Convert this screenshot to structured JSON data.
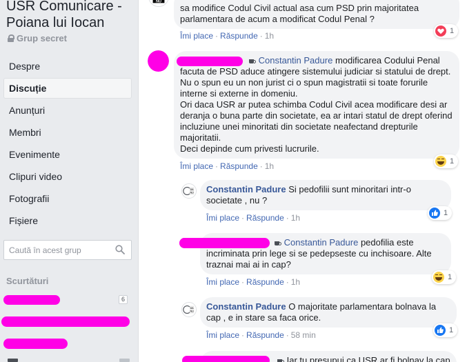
{
  "group": {
    "title": "USR Comunicare - Poiana lui Iocan",
    "privacy": "Grup secret"
  },
  "nav": [
    {
      "label": "Despre"
    },
    {
      "label": "Discuție"
    },
    {
      "label": "Anunțuri"
    },
    {
      "label": "Membri"
    },
    {
      "label": "Evenimente"
    },
    {
      "label": "Clipuri video"
    },
    {
      "label": "Fotografii"
    },
    {
      "label": "Fișiere"
    }
  ],
  "search": {
    "placeholder": "Caută în acest grup"
  },
  "shortcuts": {
    "heading": "Scurtături",
    "badge": "6"
  },
  "actions": {
    "like": "Îmi place",
    "reply": "Răspunde"
  },
  "comments": [
    {
      "text": "sa modifice Codul Civil actual asa cum PSD prin majoritatea parlamentara de acum a modificat Codul Penal ?",
      "time": "1h",
      "reaction_count": "1",
      "reaction": "love"
    },
    {
      "tag": "Constantin Padure",
      "text_first": "modificarea Codului Penal facuta de PSD aduce atingere sistemului judiciar si statului de drept.",
      "text_lines": [
        "Nu o spun eu un non jurist ci o spun magistratii si toate forurile interne si externe in domeniu.",
        "Ori daca USR ar putea schimba Codul Civil acea modificare desi ar deranja o buna parte din societate, ea ar intari statul de drept oferind incluziune unei minoritati din societate neafectand drepturile majoritatii.",
        "Deci depinde cum privesti lucrurile."
      ],
      "time": "1h",
      "reaction_count": "1",
      "reaction": "haha"
    },
    {
      "author": "Constantin Padure",
      "text": "Si pedofilii sunt minoritari intr-o societate , nu ?",
      "time": "1h",
      "reaction_count": "1",
      "reaction": "like"
    },
    {
      "tag": "Constantin Padure",
      "text": "pedofilia este incriminata prin lege si se pedepseste cu inchisoare. Alte traznai mai ai in cap?",
      "time": "1h",
      "reaction_count": "1",
      "reaction": "haha"
    },
    {
      "author": "Constantin Padure",
      "text": "O majoritate parlamentara bolnava la cap , e in stare sa faca orice.",
      "time": "58 min",
      "reaction_count": "1",
      "reaction": "like"
    },
    {
      "text": "Iar tu presupui ca USR ar fi bolnav la cap"
    }
  ],
  "colors": {
    "link": "#385898",
    "action": "#4267b2",
    "redaction": "#ff00e6",
    "sidebar_bg": "#e9ebee"
  }
}
